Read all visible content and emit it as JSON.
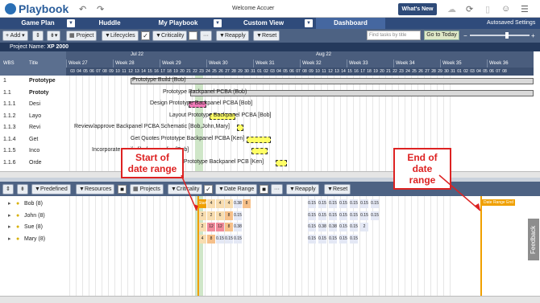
{
  "app": {
    "name": "Playbook",
    "welcome": "Welcome Accuer",
    "whats_new": "What's New"
  },
  "nav": {
    "tabs": [
      "Game Plan",
      "Huddle",
      "My Playbook",
      "Custom View",
      "Dashboard"
    ],
    "autosaved": "Autosaved Settings"
  },
  "toolbar": {
    "add": "Add",
    "project": "Project",
    "lifecycles": "Lifecycles",
    "criticality": "Criticality",
    "more": "···",
    "reapply": "Reapply",
    "reset": "Reset",
    "find_placeholder": "Find tasks by title",
    "go_to_today": "Go to Today"
  },
  "project": {
    "label": "Project Name:",
    "name": "XP 2000"
  },
  "header": {
    "wbs": "WBS",
    "title": "Title",
    "months": [
      "Jul 22",
      "Aug 22"
    ],
    "weeks": [
      "Week 27",
      "Week 28",
      "Week 29",
      "Week 30",
      "Week 31",
      "Week 32",
      "Week 33",
      "Week 34",
      "Week 35",
      "Week 36"
    ],
    "days": [
      "03",
      "04",
      "05",
      "06",
      "07",
      "08",
      "09",
      "10",
      "11",
      "12",
      "13",
      "14",
      "15",
      "16",
      "17",
      "18",
      "19",
      "20",
      "21",
      "22",
      "23",
      "24",
      "25",
      "26",
      "27",
      "28",
      "29",
      "30",
      "31",
      "01",
      "02",
      "03",
      "04",
      "05",
      "06",
      "07",
      "08",
      "09",
      "10",
      "11",
      "12",
      "13",
      "14",
      "15",
      "16",
      "17",
      "18",
      "19",
      "20",
      "21",
      "22",
      "23",
      "24",
      "25",
      "26",
      "27",
      "28",
      "29",
      "30",
      "31",
      "01",
      "02",
      "03",
      "04",
      "05",
      "06",
      "07",
      "08"
    ]
  },
  "tasks": [
    {
      "wbs": "1",
      "title": "Prototype",
      "label": "Prototype Build (Bob)"
    },
    {
      "wbs": "1.1",
      "title": "Prototy",
      "label": "Prototype Backpanel PCBA (Bob)"
    },
    {
      "wbs": "1.1.1",
      "title": "Desi",
      "label": "Design Prototype Backpanel PCBA [Bob]"
    },
    {
      "wbs": "1.1.2",
      "title": "Layo",
      "label": "Layout Prototype Backpanel PCBA [Bob]"
    },
    {
      "wbs": "1.1.3",
      "title": "Revi",
      "label": "Review/approve Backpanel PCBA Schematic [Bob,John,Mary]"
    },
    {
      "wbs": "1.1.4",
      "title": "Get",
      "label": "Get Quotes Prototype Backpanel PCBA [Ken]"
    },
    {
      "wbs": "1.1.5",
      "title": "Inco",
      "label": "Incorporate ... rify file for supplier [Bob]"
    },
    {
      "wbs": "1.1.6",
      "title": "Orde",
      "label": "Order Prototype Backpanel PCB [Ken]"
    }
  ],
  "resource_toolbar": {
    "predefined": "Predefined",
    "resources": "Resources",
    "projects": "Projects",
    "criticality": "Criticality",
    "date_range": "Date Range",
    "more": "···",
    "reapply": "Reapply",
    "reset": "Reset"
  },
  "resources": [
    {
      "name": "Bob (8)",
      "cells": [
        "Start",
        "4",
        "4",
        "4",
        "0.38",
        "8"
      ],
      "tail": [
        "0.15",
        "0.15",
        "0.15",
        "0.15",
        "0.15",
        "0.15",
        "0.15"
      ]
    },
    {
      "name": "John (8)",
      "cells": [
        "2",
        "2",
        "6",
        "8",
        "0.15"
      ],
      "tail": [
        "0.15",
        "0.15",
        "0.15",
        "0.15",
        "0.15",
        "0.15",
        "0.15"
      ]
    },
    {
      "name": "Sue (8)",
      "cells": [
        "2",
        "12",
        "12",
        "8",
        "0.38"
      ],
      "tail": [
        "0.15",
        "0.38",
        "0.38",
        "0.15",
        "0.15",
        "2"
      ]
    },
    {
      "name": "Mary (8)",
      "cells": [
        "4",
        "8",
        "0.15",
        "0.15",
        "0.15"
      ],
      "tail": [
        "0.15",
        "0.15",
        "0.15",
        "0.15",
        "0.15"
      ]
    }
  ],
  "range": {
    "start_tag": "Start",
    "end_tag": "Date Range End"
  },
  "callouts": {
    "start": "Start of date range",
    "end": "End of date range"
  },
  "feedback": "Feedback",
  "colors": {
    "nav": "#2f4b7b",
    "toolbar": "#4d6283",
    "accent": "#f0a000",
    "bar_yellow": "#ffff66",
    "bar_pink": "#f07ab8"
  }
}
